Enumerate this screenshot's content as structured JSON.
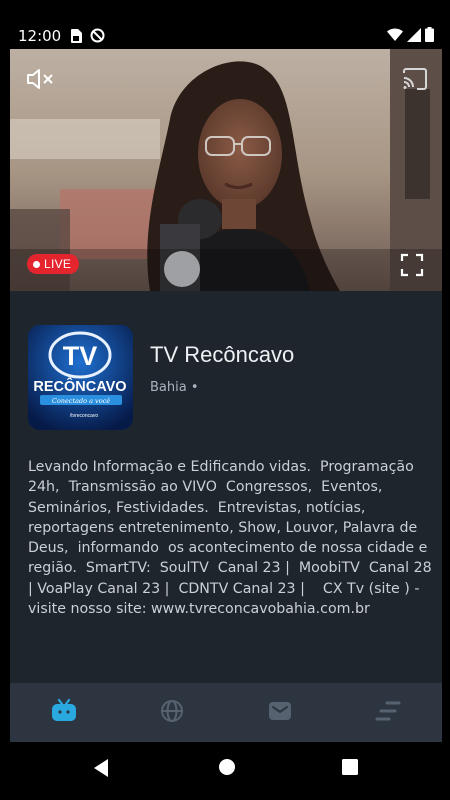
{
  "status_bar": {
    "time": "12:00"
  },
  "player": {
    "live_label": "LIVE",
    "icons": [
      "mute-icon",
      "cast-icon",
      "fullscreen-icon"
    ]
  },
  "channel": {
    "name": "TV Recôncavo",
    "region": "Bahia •",
    "logo_text": {
      "tv": "TV",
      "name": "RECÔNCAVO",
      "tagline": "Conectado a você",
      "handle": "/tvreconcavo"
    },
    "description": "Levando Informação e Edificando vidas.  Programação 24h,  Transmissão ao VIVO  Congressos,  Eventos, Seminários, Festividades.  Entrevistas, notícias, reportagens entretenimento, Show, Louvor, Palavra de Deus,  informando  os acontecimento de nossa cidade e região.  SmartTV:  SoulTV  Canal 23 |  MoobiTV  Canal 28 | VoaPlay Canal 23 |  CDNTV Canal 23 |    CX Tv (site ) - visite nosso site: www.tvreconcavobahia.com.br"
  },
  "bottom_nav": {
    "items": [
      "tv-icon",
      "globe-icon",
      "mail-icon",
      "menu-icon"
    ],
    "active_color": "#2aa8e0",
    "inactive_color": "#56626f"
  }
}
